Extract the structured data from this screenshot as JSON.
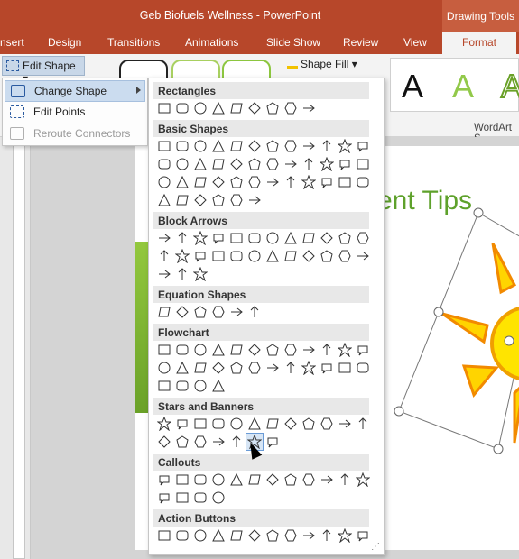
{
  "window": {
    "title": "Geb Biofuels Wellness - PowerPoint",
    "contextual_group": "Drawing Tools"
  },
  "tabs": [
    {
      "label": "nsert"
    },
    {
      "label": "Design"
    },
    {
      "label": "Transitions"
    },
    {
      "label": "Animations"
    },
    {
      "label": "Slide Show"
    },
    {
      "label": "Review"
    },
    {
      "label": "View"
    },
    {
      "label": "Format"
    }
  ],
  "ribbon": {
    "edit_shape_label": "Edit Shape",
    "shape_fill_label": "Shape Fill",
    "wordart_letter": "A",
    "wordart_group_label": "WordArt S"
  },
  "context_menu": {
    "items": [
      {
        "label": "Change Shape"
      },
      {
        "label": "Edit Points"
      },
      {
        "label": "Reroute Connectors"
      }
    ]
  },
  "gallery": {
    "categories": [
      {
        "name": "Rectangles"
      },
      {
        "name": "Basic Shapes"
      },
      {
        "name": "Block Arrows"
      },
      {
        "name": "Equation Shapes"
      },
      {
        "name": "Flowchart"
      },
      {
        "name": "Stars and Banners"
      },
      {
        "name": "Callouts"
      },
      {
        "name": "Action Buttons"
      }
    ],
    "badge_7": "7",
    "badge_8": "8",
    "badge_10": "10",
    "badge_12": "12"
  },
  "slide": {
    "title": "ent Tips",
    "body": "n"
  },
  "colors": {
    "accent": "#b7472a",
    "green": "#5ea12b",
    "highlight": "#cbdcef"
  }
}
